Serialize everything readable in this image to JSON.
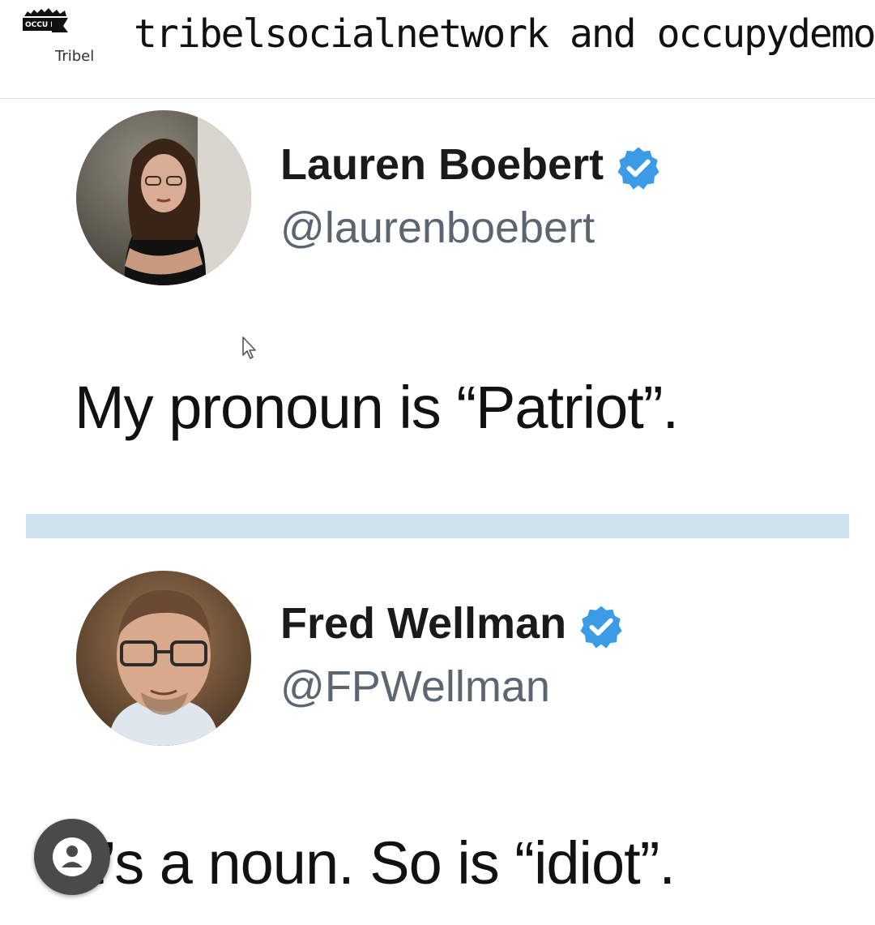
{
  "header": {
    "community_logo_text": "OCCU DEMO",
    "tribel_brand": "Tribel",
    "title": "tribelsocialnetwork and occupydemocr"
  },
  "tweets": [
    {
      "display_name": "Lauren Boebert",
      "handle": "@laurenboebert",
      "text": "My pronoun is “Patriot”."
    },
    {
      "display_name": "Fred Wellman",
      "handle": "@FPWellman",
      "text": "It’s a noun. So is “idiot”."
    }
  ],
  "colors": {
    "verified": "#3b9be6",
    "divider": "#cfe3ef",
    "chat_button": "#4a4a4a"
  },
  "icons": {
    "verified": "verified-badge-icon",
    "cursor": "mouse-cursor-icon",
    "chat": "person-chat-icon"
  }
}
